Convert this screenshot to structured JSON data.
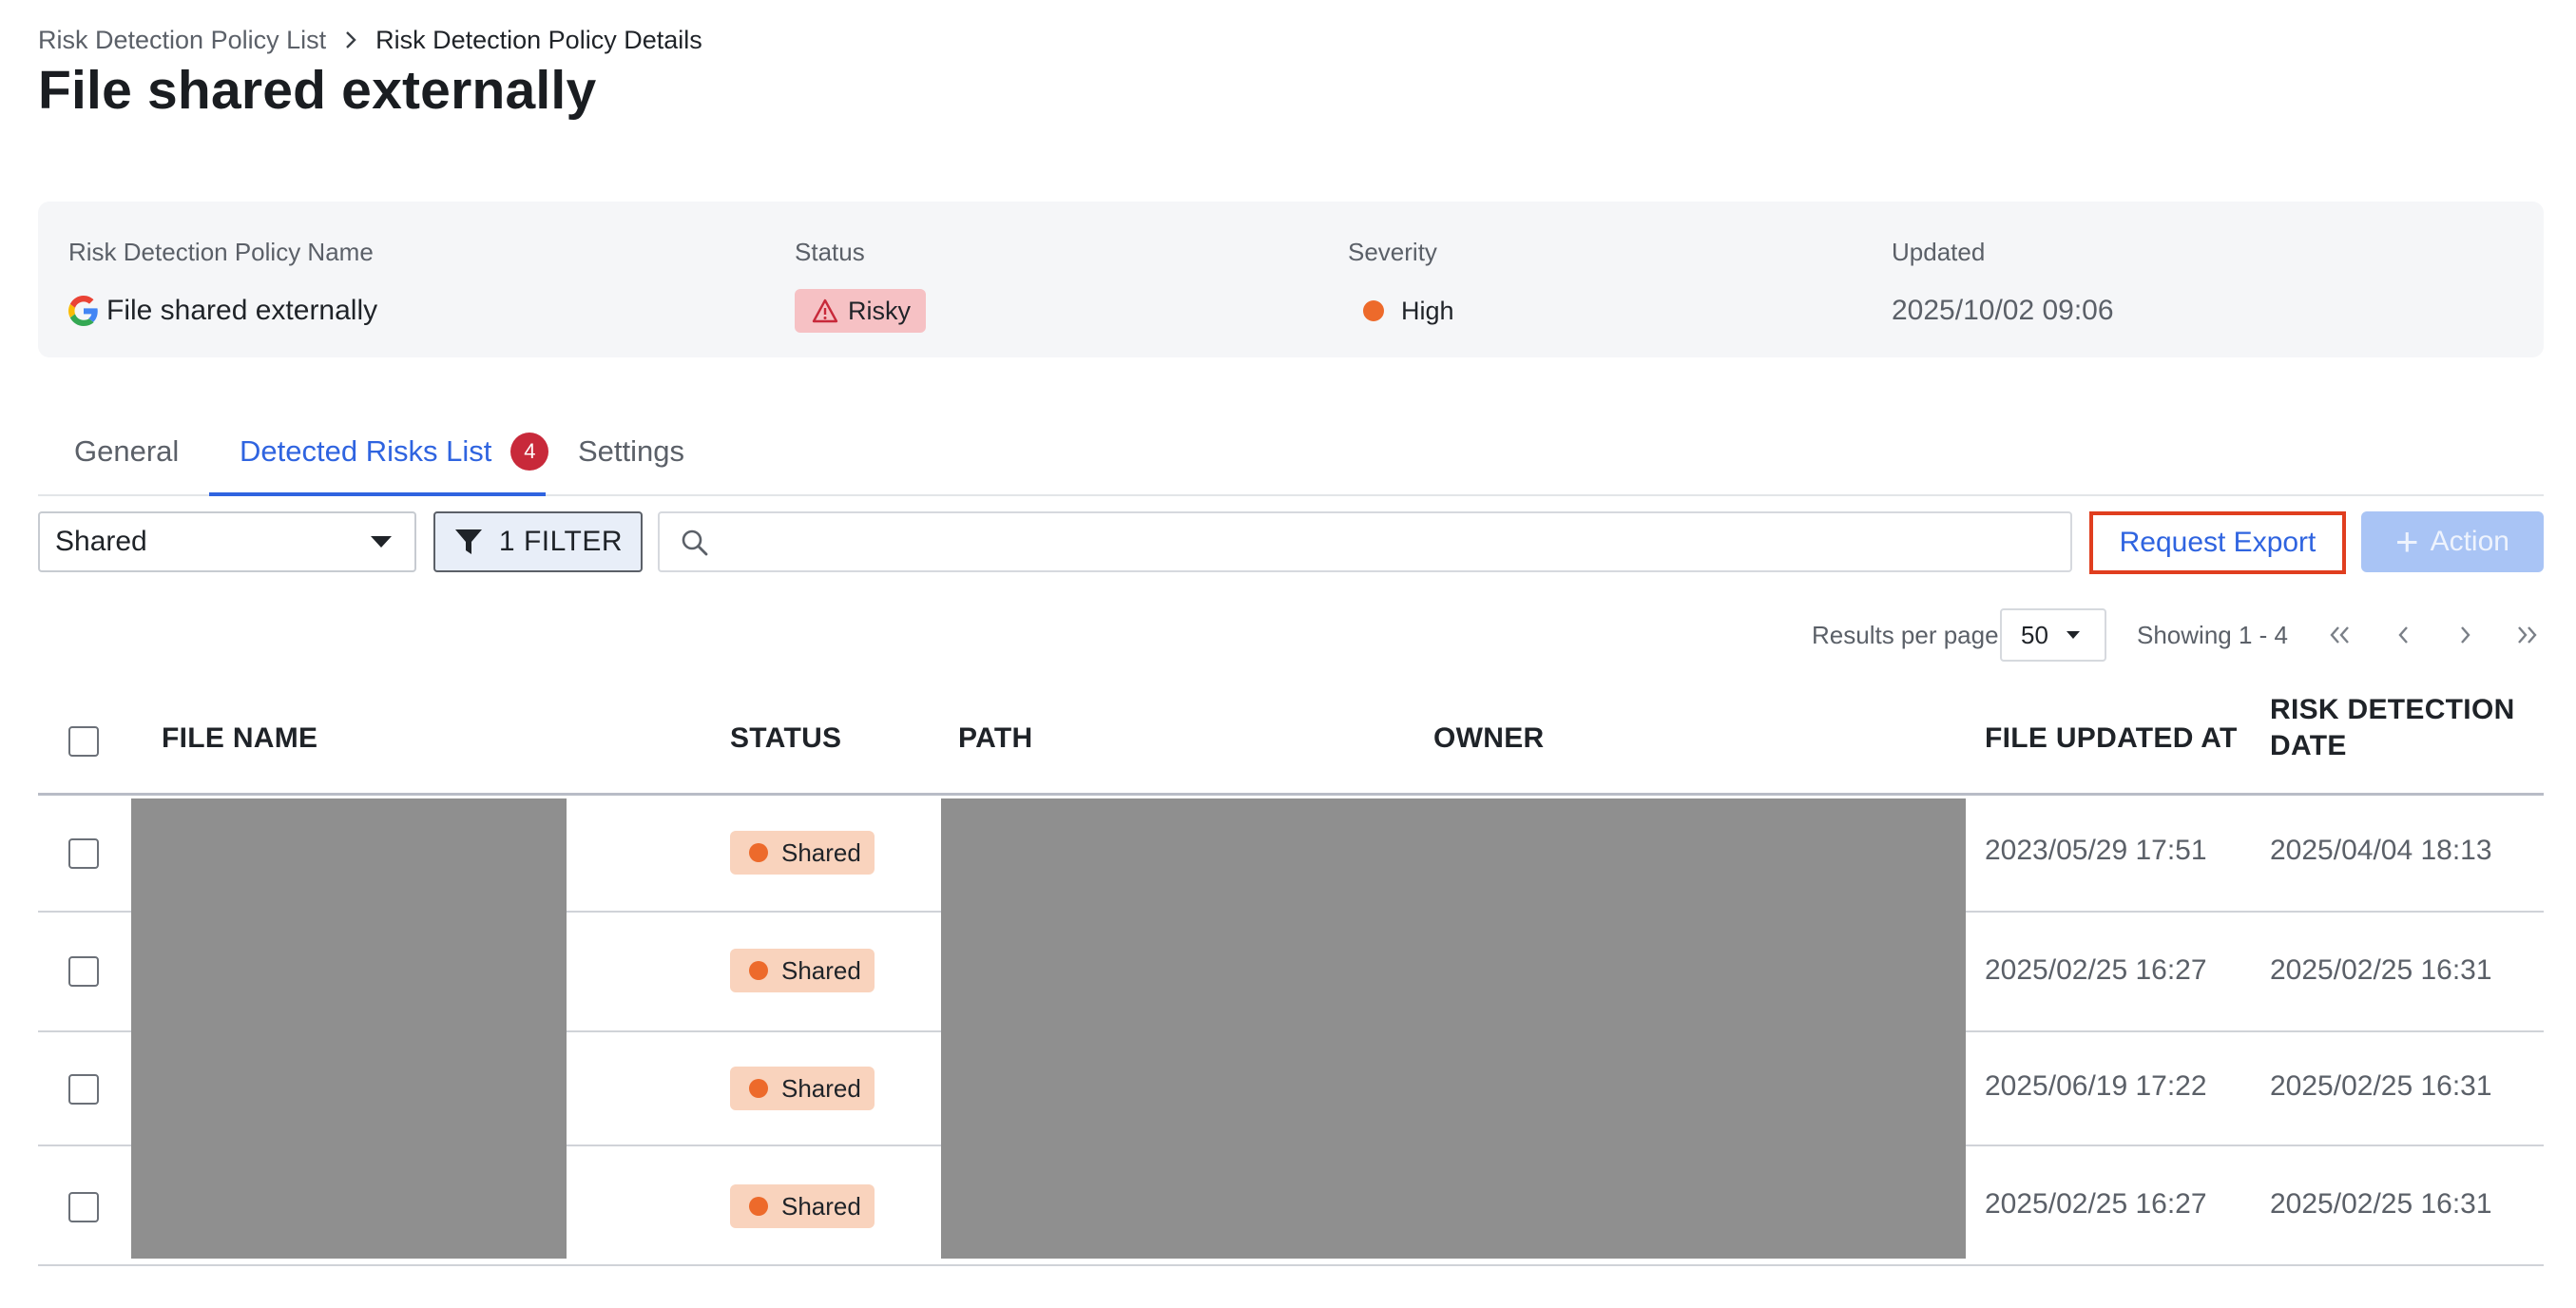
{
  "breadcrumb": {
    "parent": "Risk Detection Policy List",
    "current": "Risk Detection Policy Details"
  },
  "page_title": "File shared externally",
  "summary": {
    "policy_name_label": "Risk Detection Policy Name",
    "policy_name": "File shared externally",
    "policy_name_icon": "google-icon",
    "status_label": "Status",
    "status_value": "Risky",
    "severity_label": "Severity",
    "severity_value": "High",
    "updated_label": "Updated",
    "updated_value": "2025/10/02 09:06"
  },
  "tabs": {
    "general": "General",
    "detected": "Detected Risks List",
    "detected_count": "4",
    "settings": "Settings",
    "active": "detected"
  },
  "toolbar": {
    "select_value": "Shared",
    "filter_label": "1 FILTER",
    "search_placeholder": "",
    "export_label": "Request Export",
    "action_label": "Action"
  },
  "pagination": {
    "rpp_label": "Results per page",
    "rpp_value": "50",
    "showing": "Showing 1 - 4"
  },
  "table": {
    "headers": {
      "file_name": "FILE NAME",
      "status": "STATUS",
      "path": "PATH",
      "owner": "OWNER",
      "file_updated_at": "FILE UPDATED AT",
      "risk_line1": "RISK DETECTION",
      "risk_line2": "DATE"
    },
    "rows": [
      {
        "status": "Shared",
        "file_updated_at": "2023/05/29 17:51",
        "risk_detection_date": "2025/04/04 18:13"
      },
      {
        "status": "Shared",
        "file_updated_at": "2025/02/25 16:27",
        "risk_detection_date": "2025/02/25 16:31"
      },
      {
        "status": "Shared",
        "file_updated_at": "2025/06/19 17:22",
        "risk_detection_date": "2025/02/25 16:31"
      },
      {
        "status": "Shared",
        "file_updated_at": "2025/02/25 16:27",
        "risk_detection_date": "2025/02/25 16:31"
      }
    ]
  },
  "colors": {
    "accent": "#2f64e0",
    "risky_bg": "#f6c1c4",
    "severity_high": "#ed6a2b",
    "shared_bg": "#f9d3bd",
    "badge_red": "#c8293a",
    "export_border": "#e03e1f",
    "action_disabled": "#a9c4f5"
  }
}
